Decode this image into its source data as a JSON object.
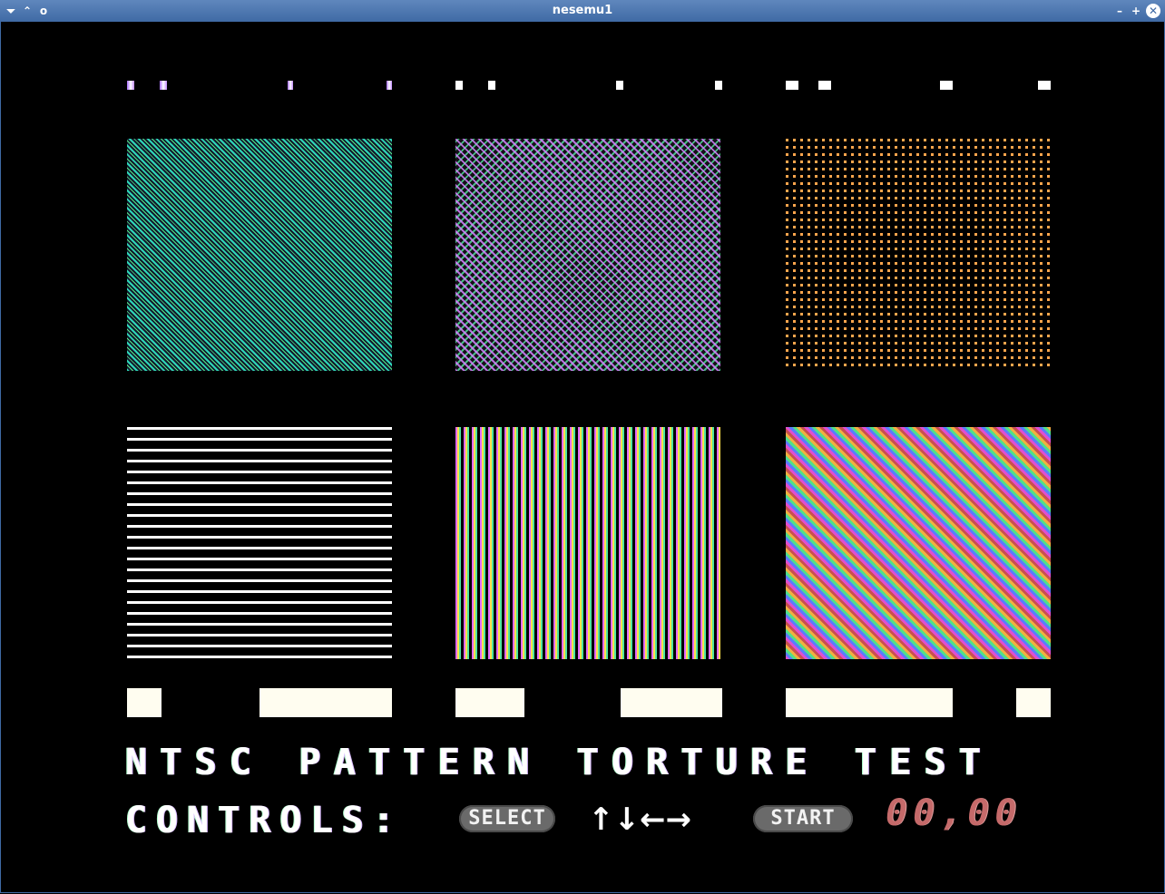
{
  "window": {
    "title": "nesemu1",
    "menu_icon": "chevron-down-icon",
    "shade_icon": "chevron-up-icon",
    "sticky_icon": "circle-icon",
    "minimize_icon": "minus",
    "maximize_icon": "plus",
    "close_icon": "close-icon",
    "minimize_glyph": "–",
    "maximize_glyph": "+",
    "close_glyph": "✕",
    "menu_glyph": "⏷",
    "shade_glyph": "⌃",
    "sticky_glyph": "o"
  },
  "screen": {
    "heading": "NTSC PATTERN TORTURE TEST",
    "controls_label": "CONTROLS:",
    "select_button": "SELECT",
    "arrows": "↑↓←→",
    "start_button": "START",
    "counter": "00,00"
  },
  "colors": {
    "title_bar": "#4a76b0",
    "background": "#000000",
    "counter": "#c56a6a",
    "pill": "#6a6a6a"
  }
}
